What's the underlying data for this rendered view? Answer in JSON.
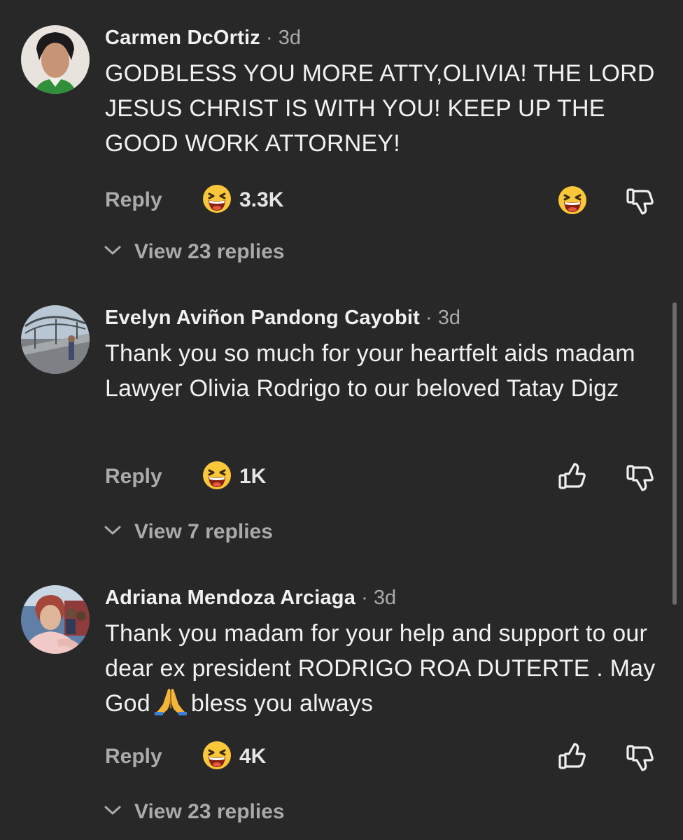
{
  "comments": [
    {
      "author": "Carmen DcOrtiz",
      "time": " · 3d",
      "text": "GODBLESS YOU MORE ATTY,OLIVIA! THE LORD JESUS CHRIST IS WITH YOU! KEEP UP THE GOOD WORK ATTORNEY!",
      "reply_label": "Reply",
      "reaction_count": "3.3K",
      "view_replies_label": "View 23 replies"
    },
    {
      "author": "Evelyn Aviñon Pandong Cayobit",
      "time": " · 3d",
      "text": "Thank you so much for  your heartfelt aids madam Lawyer Olivia Rodrigo to our beloved Tatay Digz",
      "reply_label": "Reply",
      "reaction_count": "1K",
      "view_replies_label": "View 7 replies"
    },
    {
      "author": "Adriana Mendoza Arciaga",
      "time": " · 3d",
      "text_before_emoji": "Thank you madam for your help and support to our dear ex president RODRIGO ROA DUTERTE . May God",
      "text_after_emoji": "bless you always",
      "reply_label": "Reply",
      "reaction_count": "4K",
      "view_replies_label": "View 23 replies"
    }
  ],
  "icons": {
    "reaction": "grinning-squinting-face-icon",
    "like": "thumbs-up-outline-icon",
    "dislike": "thumbs-down-outline-icon",
    "expand": "chevron-down-icon",
    "inline_emoji": "folded-hands-icon"
  },
  "colors": {
    "background": "#282828",
    "primary_text": "#f1f1f1",
    "secondary_text": "#aaaaaa",
    "emoji_yellow": "#f9c73a",
    "emoji_mouth": "#8a1f16"
  }
}
